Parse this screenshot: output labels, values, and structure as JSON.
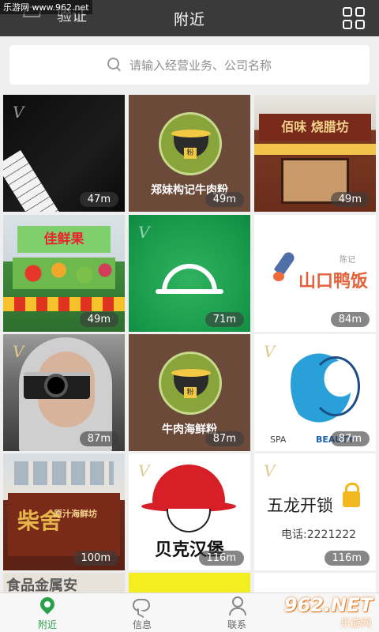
{
  "watermark": {
    "top_left": "乐游网 www.962.net",
    "bottom_right_main": "962.NET",
    "bottom_right_sub": "乐游网"
  },
  "header": {
    "left_text": "验证",
    "title": "附近"
  },
  "search": {
    "placeholder": "请输入经营业务、公司名称"
  },
  "tiles": [
    {
      "distance": "47m"
    },
    {
      "distance": "49m",
      "label": "郑妹构记牛肉粉",
      "badge": "粉"
    },
    {
      "distance": "49m",
      "sign": "佰味 烧腊坊"
    },
    {
      "distance": "49m",
      "sign": "佳鲜果"
    },
    {
      "distance": "71m"
    },
    {
      "distance": "84m",
      "label": "山口鸭饭",
      "sub": "陈记"
    },
    {
      "distance": "87m"
    },
    {
      "distance": "87m",
      "label": "牛肉海鲜粉",
      "badge": "粉"
    },
    {
      "distance": "87m",
      "left": "SPA",
      "right": "BEAUTY"
    },
    {
      "distance": "100m",
      "sign": "柴舍",
      "sub": "原汁海鲜坊"
    },
    {
      "distance": "116m",
      "label": "贝克汉堡"
    },
    {
      "distance": "116m",
      "label": "五龙开锁",
      "phone": "电话:2221222"
    }
  ],
  "partial_row": {
    "text": "食品金属安"
  },
  "tabs": [
    {
      "label": "附近",
      "icon": "location-pin-icon",
      "active": true
    },
    {
      "label": "信息",
      "icon": "chat-bubble-icon",
      "active": false
    },
    {
      "label": "联系",
      "icon": "contacts-icon",
      "active": false
    }
  ],
  "colors": {
    "header_bg": "#3a3a3a",
    "accent": "#2aa04a"
  }
}
